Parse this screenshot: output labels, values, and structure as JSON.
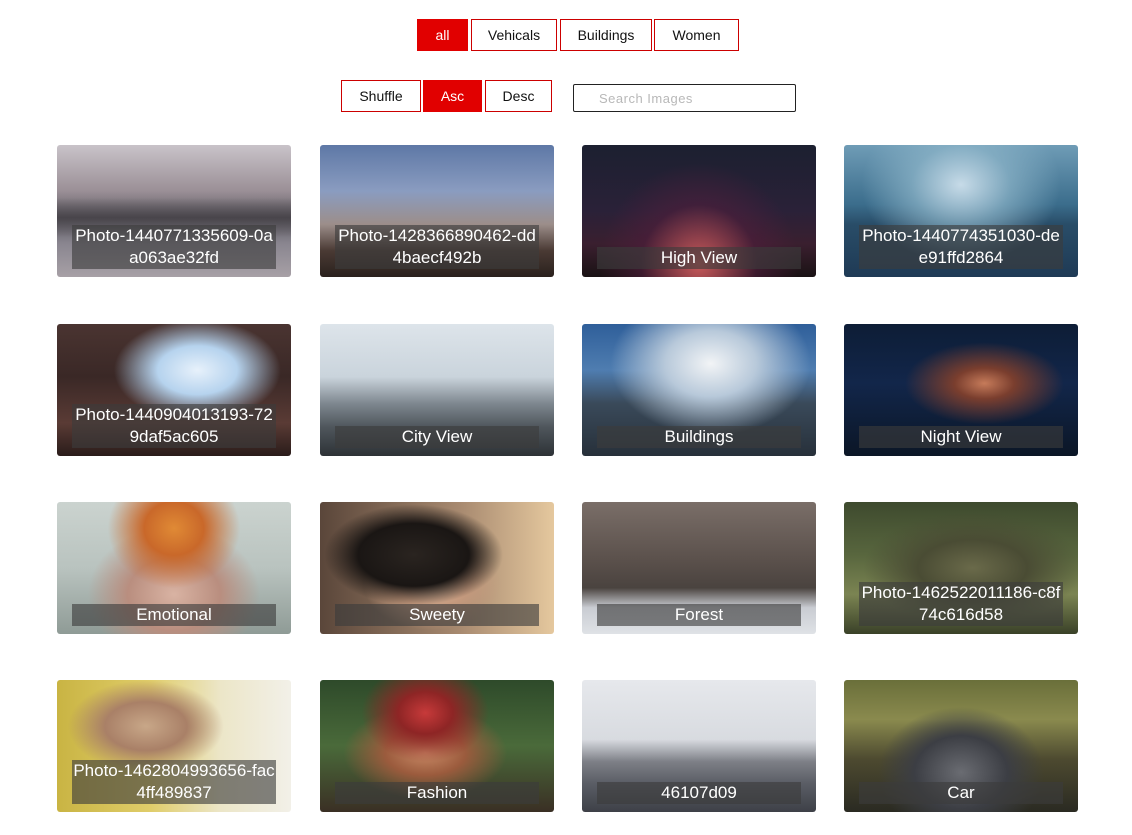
{
  "filters": [
    {
      "label": "all",
      "active": true
    },
    {
      "label": "Vehicals",
      "active": false
    },
    {
      "label": "Buildings",
      "active": false
    },
    {
      "label": "Women",
      "active": false
    }
  ],
  "sort": [
    {
      "label": "Shuffle",
      "active": false
    },
    {
      "label": "Asc",
      "active": true
    },
    {
      "label": "Desc",
      "active": false
    }
  ],
  "search": {
    "placeholder": "Search Images",
    "value": ""
  },
  "gallery": [
    {
      "caption": "Photo-1440771335609-0aa063ae32fd",
      "scene": "city-reflection"
    },
    {
      "caption": "Photo-1428366890462-dd4baecf492b",
      "scene": "tower-dusk"
    },
    {
      "caption": "High View",
      "scene": "night-skyline"
    },
    {
      "caption": "Photo-1440774351030-dee91ffd2864",
      "scene": "blue-skyline"
    },
    {
      "caption": "Photo-1440904013193-729daf5ac605",
      "scene": "courtyard"
    },
    {
      "caption": "City View",
      "scene": "city-view"
    },
    {
      "caption": "Buildings",
      "scene": "towers-clouds"
    },
    {
      "caption": "Night View",
      "scene": "night-building"
    },
    {
      "caption": "Emotional",
      "scene": "flower-crown"
    },
    {
      "caption": "Sweety",
      "scene": "portrait-warm"
    },
    {
      "caption": "Forest",
      "scene": "forest-woman"
    },
    {
      "caption": "Photo-1462522011186-c8f74c616d58",
      "scene": "green-portrait"
    },
    {
      "caption": "Photo-1462804993656-fac4ff489837",
      "scene": "yellow-wall"
    },
    {
      "caption": "Fashion",
      "scene": "fashion"
    },
    {
      "caption": "46107d09",
      "scene": "parking-lot"
    },
    {
      "caption": "Car",
      "scene": "car"
    }
  ],
  "colors": {
    "accent": "#e10000",
    "border": "#cc0000"
  }
}
